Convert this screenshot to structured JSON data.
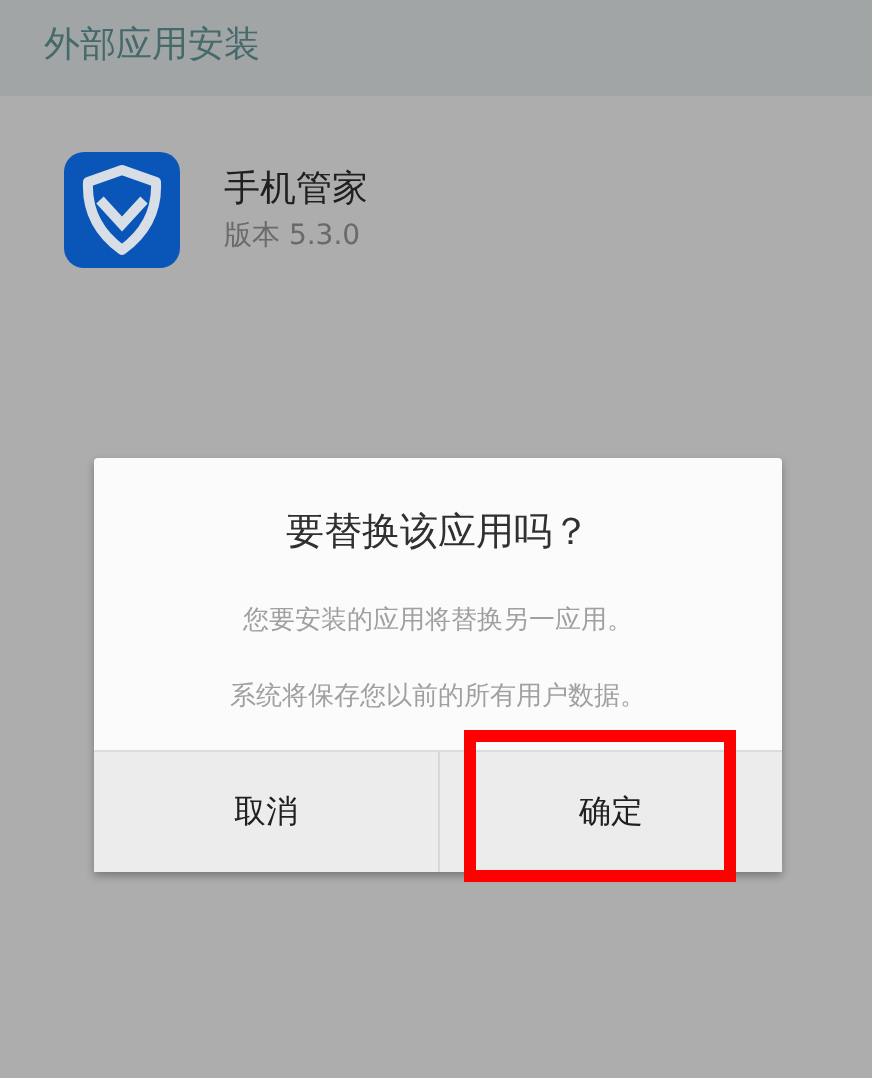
{
  "header": {
    "title": "外部应用安装"
  },
  "app": {
    "name": "手机管家",
    "version": "版本 5.3.0"
  },
  "dialog": {
    "title": "要替换该应用吗？",
    "messages": [
      "您要安装的应用将替换另一应用。",
      "系统将保存您以前的所有用户数据。"
    ],
    "buttons": [
      {
        "label": "取消",
        "highlighted": false
      },
      {
        "label": "确定",
        "highlighted": true
      }
    ]
  }
}
